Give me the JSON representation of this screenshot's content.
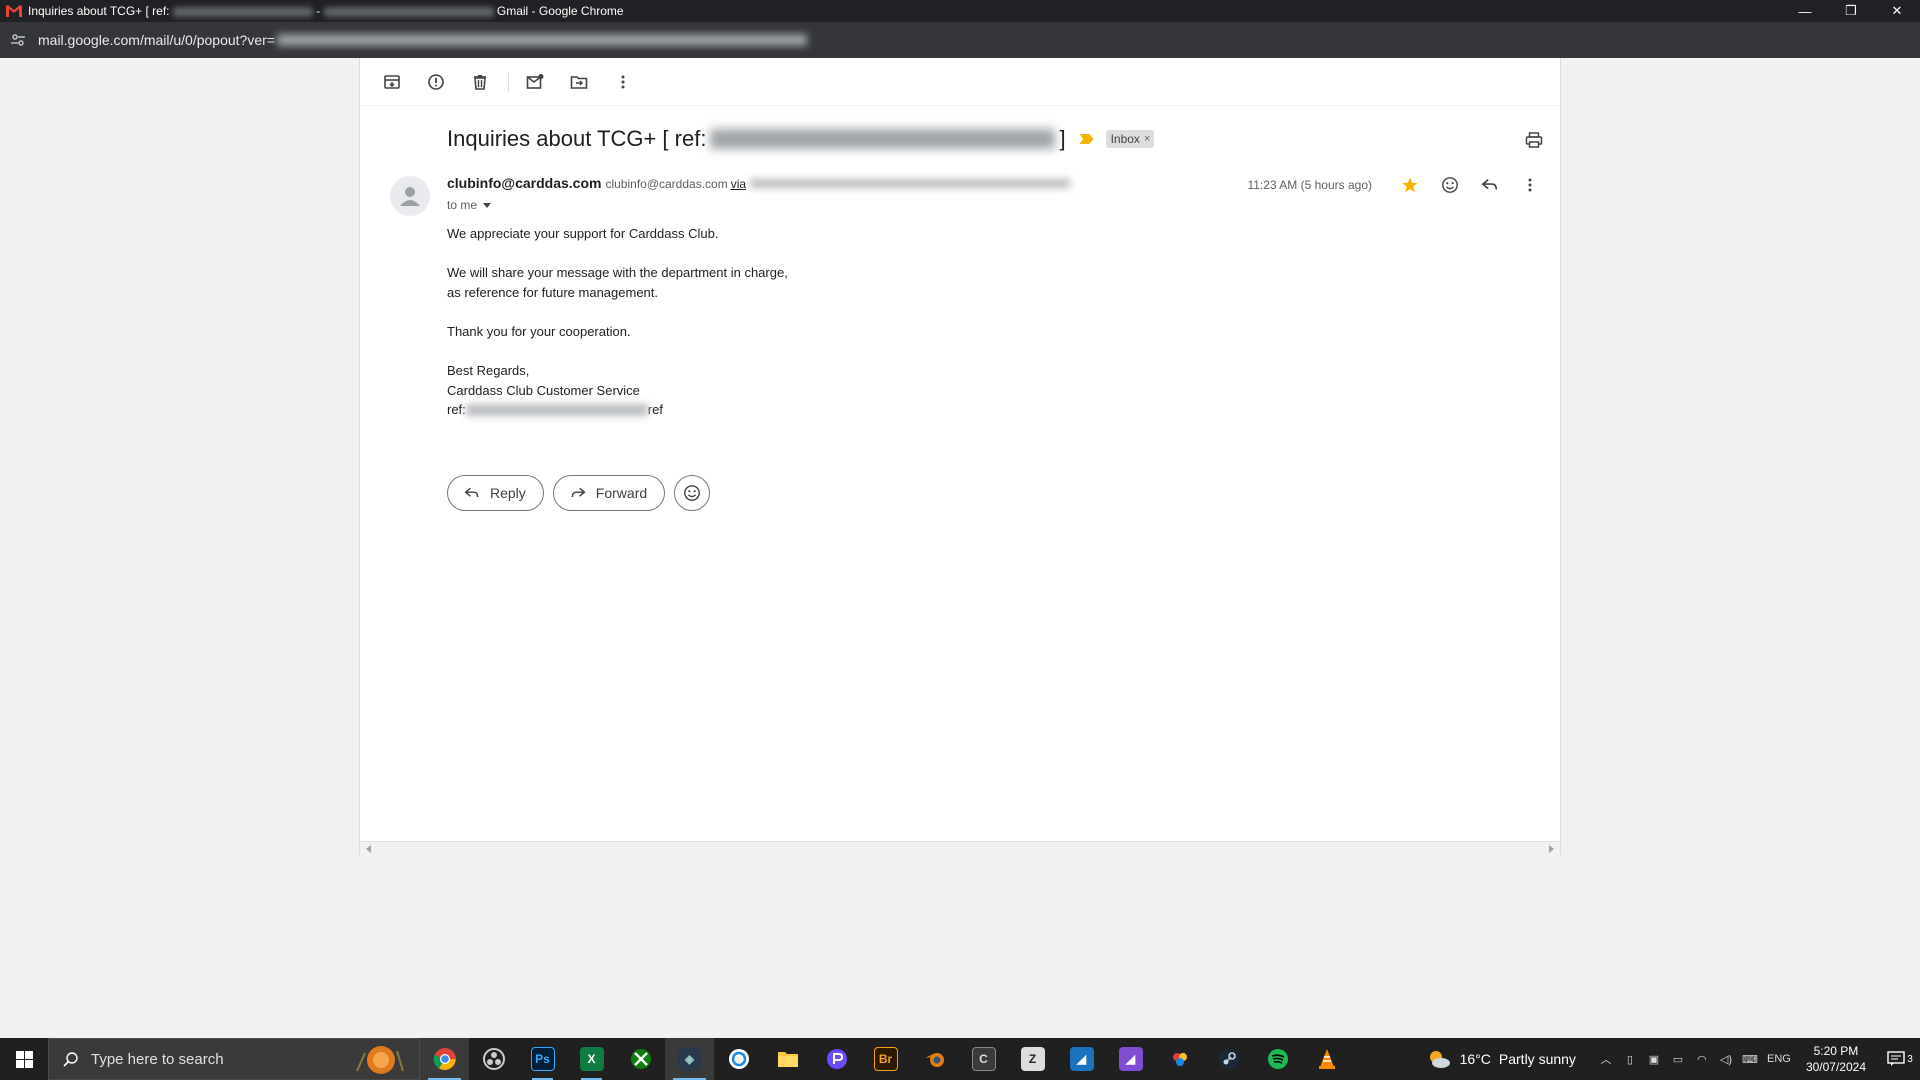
{
  "window": {
    "title_prefix": "Inquiries about TCG+ [ ref:",
    "title_sep": "-",
    "title_suffix": "Gmail - Google Chrome",
    "controls": [
      "—",
      "❐",
      "✕"
    ]
  },
  "address_bar": {
    "url": "mail.google.com/mail/u/0/popout?ver="
  },
  "toolbar": {
    "buttons": [
      "archive-icon",
      "report-spam-icon",
      "delete-icon",
      "mark-unread-icon",
      "move-to-icon",
      "more-vert-icon"
    ]
  },
  "email": {
    "subject_prefix": "Inquiries about TCG+ [ ref:",
    "subject_suffix": "]",
    "label_chip": "Inbox",
    "label_close": "×",
    "sender_name": "clubinfo@carddas.com",
    "sender_email": "clubinfo@carddas.com",
    "via": "via",
    "recipient": "to me",
    "time": "11:23 AM (5 hours ago)",
    "starred": true,
    "body": {
      "line1": "We appreciate your support for Carddass Club.",
      "line2": "We will share your message with the department in charge,",
      "line3": "as reference for future management.",
      "line4": "Thank you for your cooperation.",
      "line5": "Best Regards,",
      "line6": "Carddass Club Customer Service",
      "ref_prefix": "ref:",
      "ref_suffix": "ref"
    },
    "actions": {
      "reply": "Reply",
      "forward": "Forward"
    }
  },
  "taskbar": {
    "search_placeholder": "Type here to search",
    "apps": [
      "chrome",
      "obs",
      "photoshop",
      "excel",
      "xbox",
      "davinci",
      "edge-like",
      "file-explorer",
      "proton",
      "bridge",
      "blender",
      "unknown-c",
      "zbrush",
      "affinity-designer",
      "affinity-photo",
      "davinci-2",
      "steam",
      "spotify",
      "vlc"
    ],
    "weather_temp": "16°C",
    "weather_desc": "Partly sunny",
    "language": "ENG",
    "time": "5:20 PM",
    "date": "30/07/2024",
    "notif_count": "3"
  },
  "colors": {
    "star": "#f4b400",
    "accent": "#76b9ed"
  }
}
